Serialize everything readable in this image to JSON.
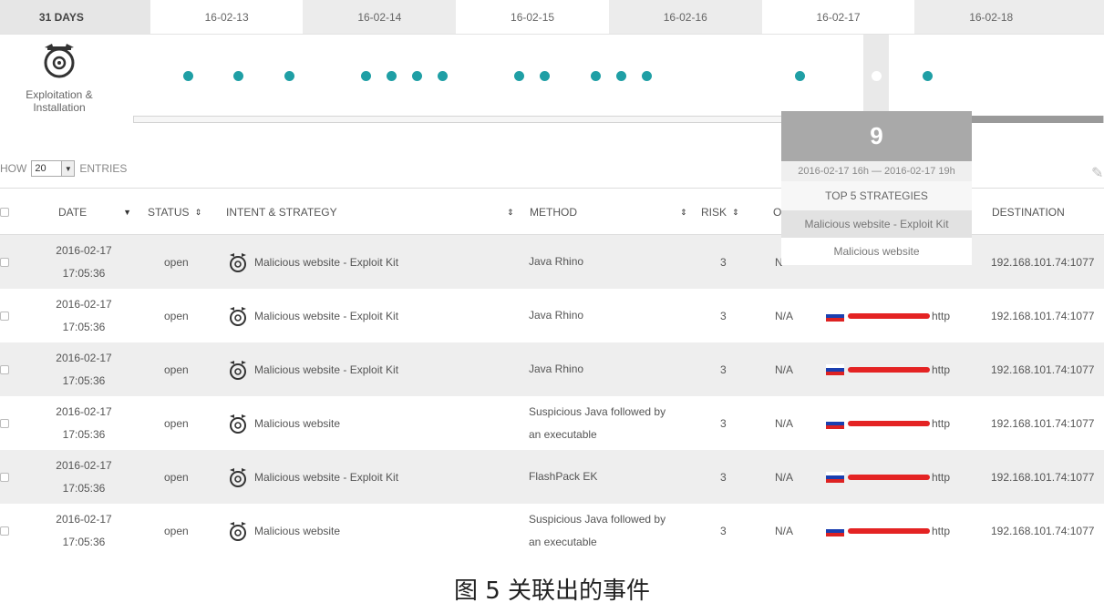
{
  "datebar": {
    "range_label": "31 DAYS",
    "days": [
      "16-02-13",
      "16-02-14",
      "16-02-15",
      "16-02-16",
      "16-02-17",
      "16-02-18"
    ]
  },
  "timeline": {
    "phase_label": "Exploitation & Installation",
    "phase_icon": "alarm-clock-icon",
    "dot_color": "#1f9fa5"
  },
  "tooltip": {
    "count": "9",
    "range": "2016-02-17 16h — 2016-02-17 19h",
    "header": "TOP 5 STRATEGIES",
    "items": [
      "Malicious website - Exploit Kit",
      "Malicious website"
    ]
  },
  "controls": {
    "show_label": "HOW",
    "entries_value": "20",
    "entries_label": "ENTRIES"
  },
  "table": {
    "headers": {
      "date": "DATE",
      "status": "STATUS",
      "intent": "INTENT & STRATEGY",
      "method": "METHOD",
      "risk": "RISK",
      "origin": "O",
      "destination": "DESTINATION"
    },
    "rows": [
      {
        "date": "2016-02-17",
        "time": "17:05:36",
        "status": "open",
        "intent": "Malicious website - Exploit Kit",
        "method1": "Java Rhino",
        "method2": "",
        "risk": "3",
        "origin": "N",
        "source": "",
        "dest": "192.168.101.74:1077"
      },
      {
        "date": "2016-02-17",
        "time": "17:05:36",
        "status": "open",
        "intent": "Malicious website - Exploit Kit",
        "method1": "Java Rhino",
        "method2": "",
        "risk": "3",
        "origin": "N/A",
        "source": "http",
        "dest": "192.168.101.74:1077"
      },
      {
        "date": "2016-02-17",
        "time": "17:05:36",
        "status": "open",
        "intent": "Malicious website - Exploit Kit",
        "method1": "Java Rhino",
        "method2": "",
        "risk": "3",
        "origin": "N/A",
        "source": "http",
        "dest": "192.168.101.74:1077"
      },
      {
        "date": "2016-02-17",
        "time": "17:05:36",
        "status": "open",
        "intent": "Malicious website",
        "method1": "Suspicious Java followed by",
        "method2": "an executable",
        "risk": "3",
        "origin": "N/A",
        "source": "http",
        "dest": "192.168.101.74:1077"
      },
      {
        "date": "2016-02-17",
        "time": "17:05:36",
        "status": "open",
        "intent": "Malicious website - Exploit Kit",
        "method1": "FlashPack EK",
        "method2": "",
        "risk": "3",
        "origin": "N/A",
        "source": "http",
        "dest": "192.168.101.74:1077"
      },
      {
        "date": "2016-02-17",
        "time": "17:05:36",
        "status": "open",
        "intent": "Malicious website",
        "method1": "Suspicious Java followed by",
        "method2": "an executable",
        "risk": "3",
        "origin": "N/A",
        "source": "http",
        "dest": "192.168.101.74:1077"
      }
    ]
  },
  "caption": "图 5  关联出的事件"
}
